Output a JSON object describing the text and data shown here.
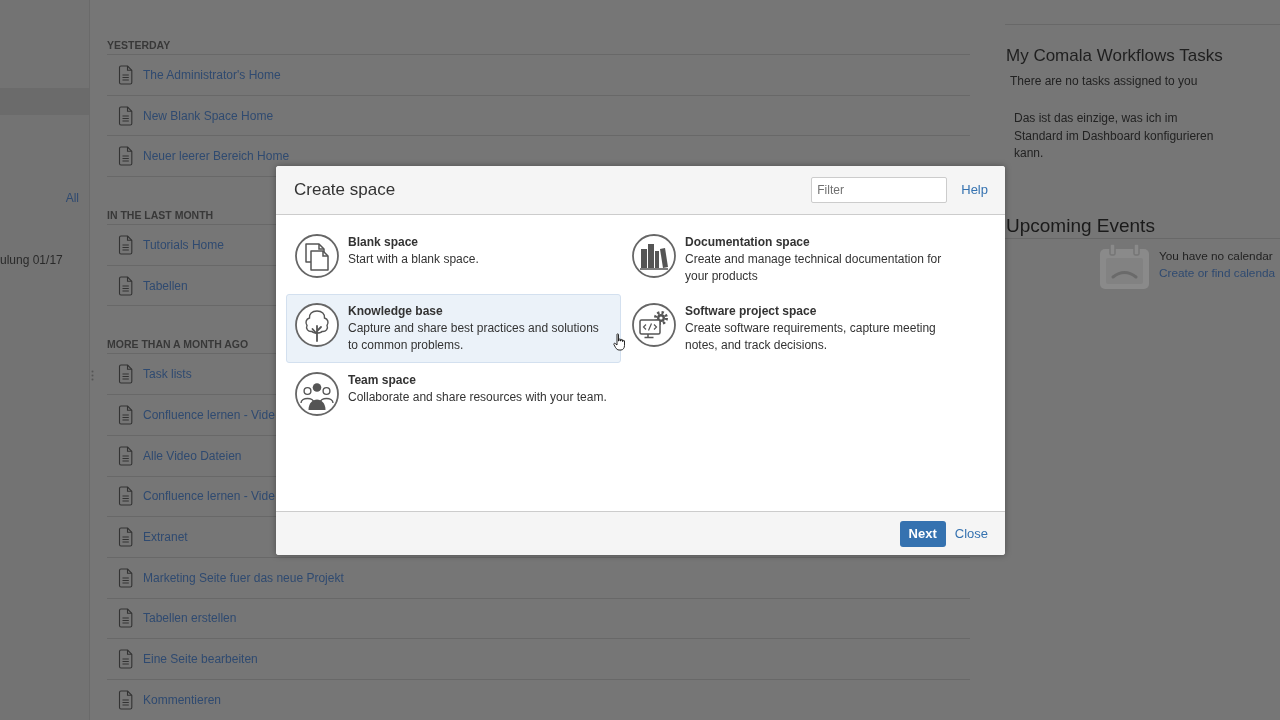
{
  "sidebar": {
    "link": "All",
    "item": "ulung 01/17"
  },
  "main": {
    "sections": [
      {
        "heading": "YESTERDAY",
        "items": [
          "The Administrator's Home",
          "New Blank Space Home",
          "Neuer leerer Bereich Home"
        ]
      },
      {
        "heading": "IN THE LAST MONTH",
        "items": [
          "Tutorials Home",
          "Tabellen"
        ]
      },
      {
        "heading": "MORE THAN A MONTH AGO",
        "items": [
          "Task lists",
          "Confluence lernen - Vide",
          "Alle Video Dateien",
          "Confluence lernen - Vide",
          "Extranet",
          "Marketing Seite fuer das neue Projekt",
          "Tabellen erstellen",
          "Eine Seite bearbeiten",
          "Kommentieren"
        ]
      }
    ]
  },
  "right_panel": {
    "tasks": {
      "title": "My Comala Workflows Tasks",
      "empty_text": "There are no tasks assigned to you",
      "note": "Das ist das einzige, was ich im Standard im Dashboard konfigurieren kann."
    },
    "events": {
      "title": "Upcoming Events",
      "empty_text": "You have no calendar",
      "link": "Create or find calenda"
    }
  },
  "dialog": {
    "title": "Create space",
    "filter": {
      "placeholder": "Filter"
    },
    "help": "Help",
    "options": [
      {
        "title": "Blank space",
        "description": "Start with a blank space.",
        "selected": false
      },
      {
        "title": "Documentation space",
        "description": "Create and manage technical documentation for your products",
        "selected": false
      },
      {
        "title": "Knowledge base",
        "description": "Capture and share best practices and solutions to common problems.",
        "selected": true
      },
      {
        "title": "Software project space",
        "description": "Create software requirements, capture meeting notes, and track decisions.",
        "selected": false
      },
      {
        "title": "Team space",
        "description": "Collaborate and share resources with your team.",
        "selected": false
      }
    ],
    "buttons": {
      "next": "Next",
      "close": "Close"
    }
  }
}
